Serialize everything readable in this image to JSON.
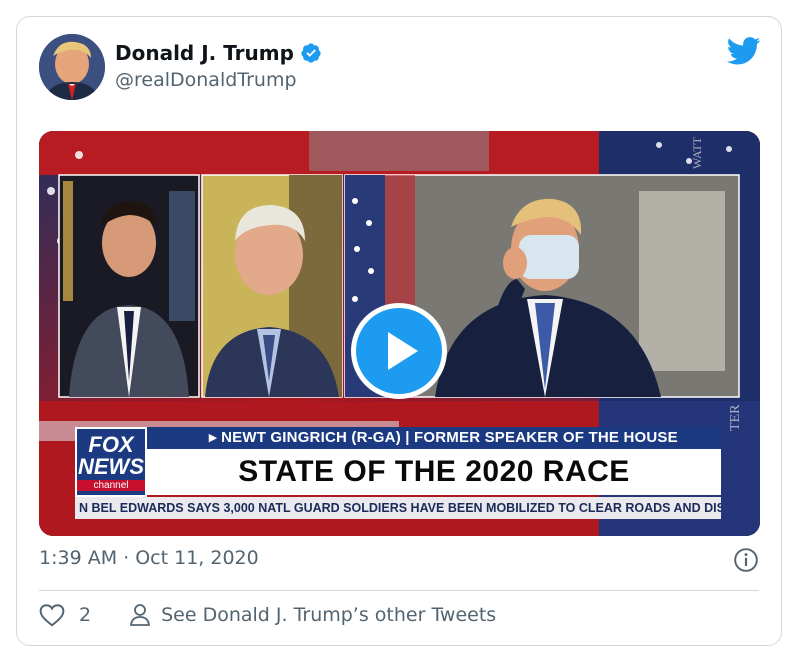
{
  "tweet": {
    "author_name": "Donald J. Trump",
    "handle": "@realDonaldTrump",
    "timestamp": "1:39 AM · Oct 11, 2020",
    "like_count": "2",
    "see_more_label": "See Donald J. Trump’s other Tweets"
  },
  "media": {
    "lower_third_top": "▸ NEWT GINGRICH (R-GA) | FORMER SPEAKER OF THE HOUSE",
    "lower_third_main": "STATE OF THE 2020 RACE",
    "ticker": "N BEL EDWARDS SAYS 3,000 NATL GUARD SOLDIERS HAVE BEEN MOBILIZED TO CLEAR ROADS AND DISTRIB",
    "logo_word_1": "FOX",
    "logo_word_2": "NEWS",
    "logo_channel": "channel"
  },
  "icons": {
    "verified": "verified-badge-icon",
    "bird": "twitter-bird-icon",
    "play": "play-icon",
    "info": "info-icon",
    "heart": "heart-icon",
    "person": "person-icon"
  },
  "colors": {
    "accent": "#1d9bf0",
    "text_primary": "#0f1419",
    "text_secondary": "#536471",
    "border": "#cfd9de",
    "fox_blue": "#1c3a82",
    "fox_red": "#c8102e"
  }
}
